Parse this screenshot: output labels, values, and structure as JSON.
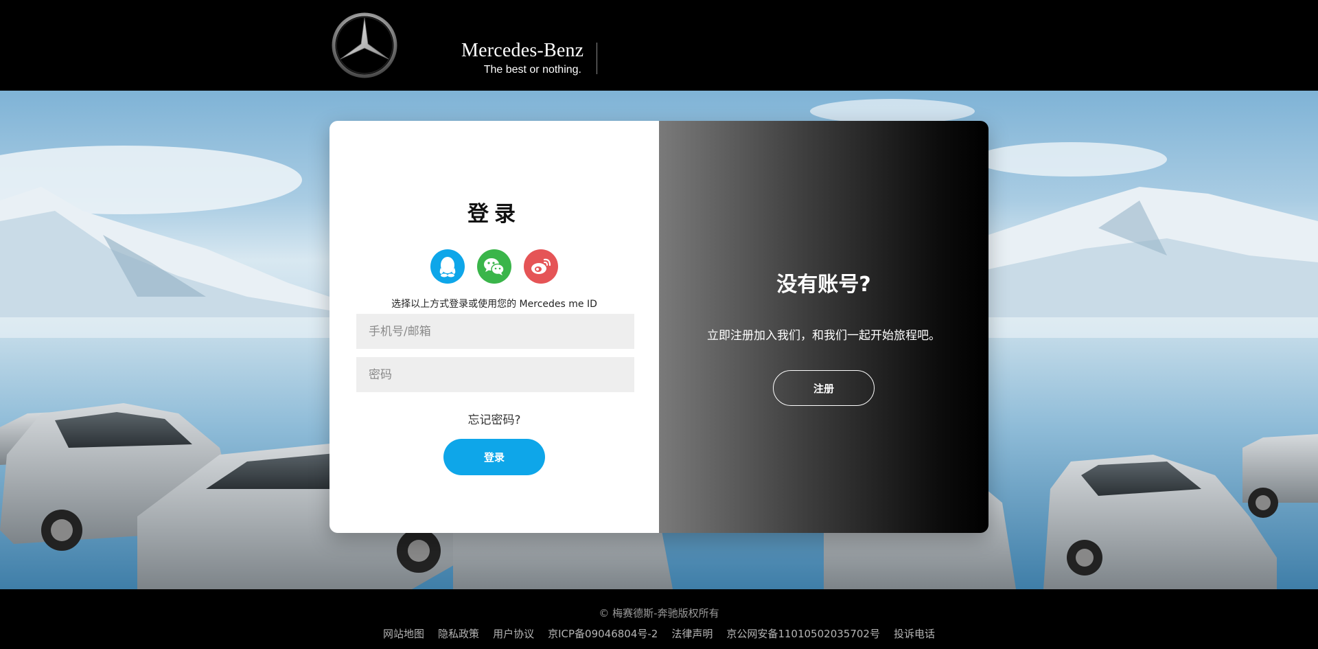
{
  "header": {
    "logo_icon": "mercedes-star-icon",
    "brand_name": "Mercedes-Benz",
    "slogan": "The best or nothing."
  },
  "login": {
    "title": "登录",
    "social": [
      {
        "name": "qq",
        "icon": "qq-penguin-icon",
        "color": "#0ea6e9"
      },
      {
        "name": "wechat",
        "icon": "wechat-icon",
        "color": "#3ab54a"
      },
      {
        "name": "weibo",
        "icon": "weibo-icon",
        "color": "#e55456"
      }
    ],
    "hint": "选择以上方式登录或使用您的 Mercedes me ID",
    "phone_placeholder": "手机号/邮箱",
    "password_placeholder": "密码",
    "forgot": "忘记密码?",
    "submit": "登录"
  },
  "register": {
    "title": "没有账号?",
    "text": "立即注册加入我们，和我们一起开始旅程吧。",
    "button": "注册"
  },
  "footer": {
    "copyright": "© 梅赛德斯-奔驰版权所有",
    "links": [
      "网站地图",
      "隐私政策",
      "用户协议",
      "京ICP备09046804号-2",
      "法律声明",
      "京公网安备11010502035702号",
      "投诉电话"
    ]
  },
  "colors": {
    "accent": "#0ea6e9",
    "header_bg": "#000000",
    "field_bg": "#eeeeee"
  }
}
